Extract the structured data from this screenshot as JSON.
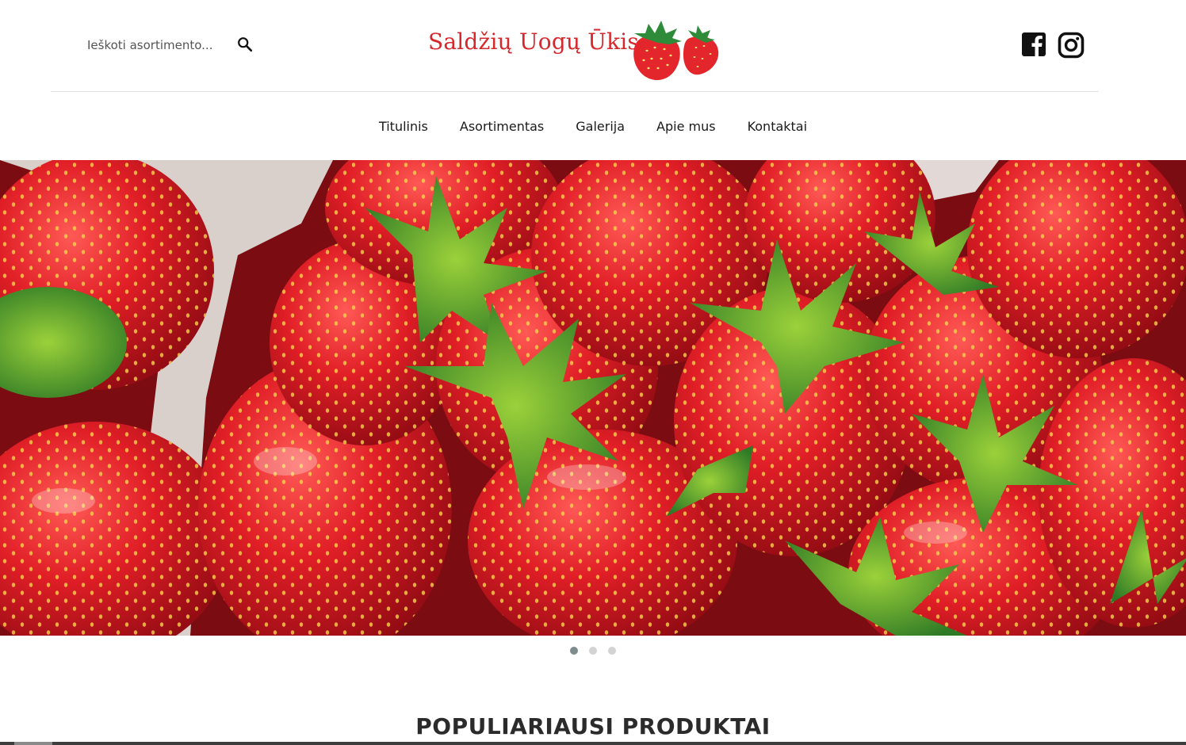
{
  "header": {
    "search": {
      "placeholder": "Ieškoti asortimento..."
    },
    "logo_text": "Saldžių Uogų Ūkis",
    "social": {
      "facebook_icon": "facebook-icon",
      "instagram_icon": "instagram-icon"
    }
  },
  "nav": {
    "items": [
      {
        "label": "Titulinis"
      },
      {
        "label": "Asortimentas"
      },
      {
        "label": "Galerija"
      },
      {
        "label": "Apie mus"
      },
      {
        "label": "Kontaktai"
      }
    ]
  },
  "slider": {
    "slide_count": 3,
    "active_slide": 1
  },
  "sections": {
    "popular_title": "POPULIARIAUSI PRODUKTAI"
  },
  "colors": {
    "brand_red": "#d6282c",
    "text": "#1a1a1a",
    "dot_active": "#7f8c8d",
    "dot_inactive": "#d3d3d3"
  }
}
